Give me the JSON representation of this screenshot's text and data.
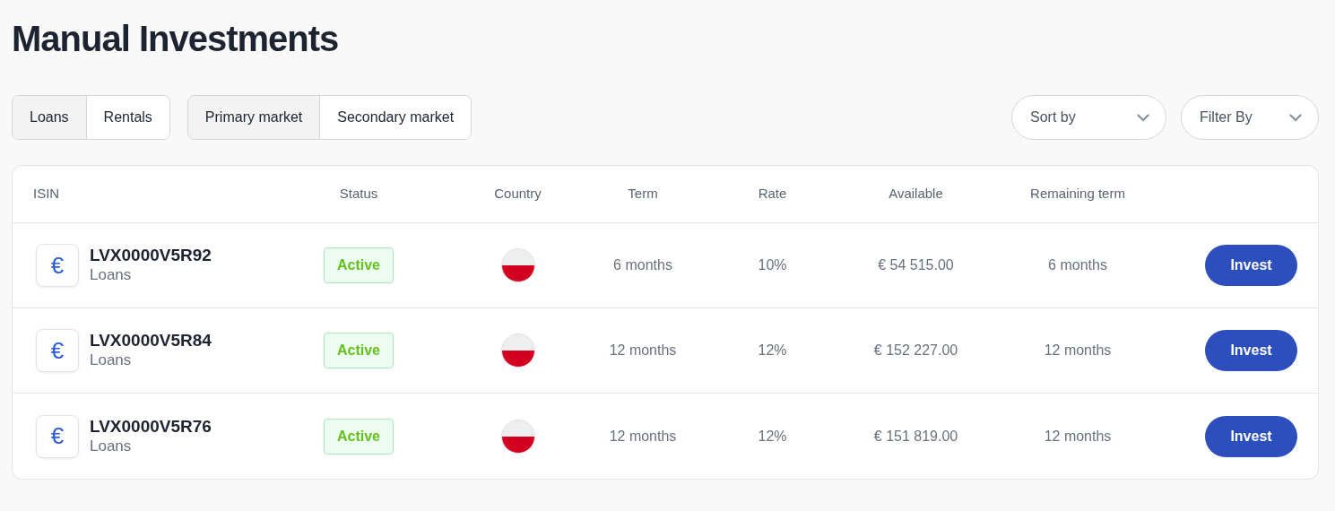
{
  "title": "Manual Investments",
  "type_tabs": [
    {
      "label": "Loans",
      "selected": true
    },
    {
      "label": "Rentals",
      "selected": false
    }
  ],
  "market_tabs": [
    {
      "label": "Primary market",
      "selected": true
    },
    {
      "label": "Secondary market",
      "selected": false
    }
  ],
  "dropdowns": [
    {
      "label": "Sort by"
    },
    {
      "label": "Filter By"
    }
  ],
  "table": {
    "columns": [
      "ISIN",
      "Status",
      "Country",
      "Term",
      "Rate",
      "Available",
      "Remaining term"
    ],
    "rows": [
      {
        "icon": "€",
        "isin": "LVX0000V5R92",
        "type": "Loans",
        "status": "Active",
        "term": "6 months",
        "rate": "10%",
        "available": "€ 54 515.00",
        "remaining": "6 months",
        "action": "Invest"
      },
      {
        "icon": "€",
        "isin": "LVX0000V5R84",
        "type": "Loans",
        "status": "Active",
        "term": "12 months",
        "rate": "12%",
        "available": "€ 152 227.00",
        "remaining": "12 months",
        "action": "Invest"
      },
      {
        "icon": "€",
        "isin": "LVX0000V5R76",
        "type": "Loans",
        "status": "Active",
        "term": "12 months",
        "rate": "12%",
        "available": "€ 151 819.00",
        "remaining": "12 months",
        "action": "Invest"
      }
    ]
  }
}
